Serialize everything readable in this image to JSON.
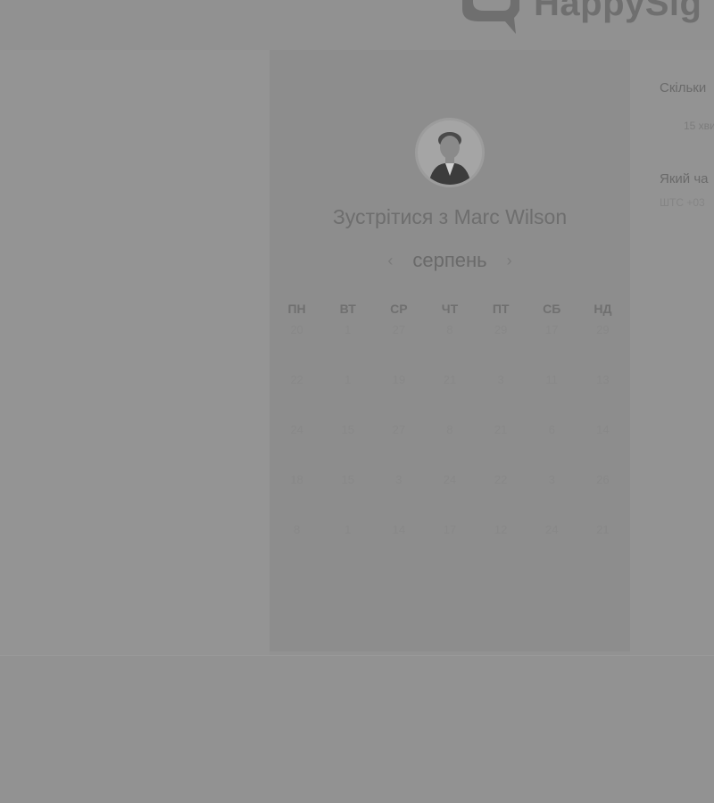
{
  "header": {
    "brand": "HappySig"
  },
  "card": {
    "title": "Зустрітися з Marc Wilson",
    "month": "серпень",
    "prev_icon": "chevron-left-icon",
    "next_icon": "chevron-right-icon",
    "weekdays": [
      "ПН",
      "ВТ",
      "СР",
      "ЧТ",
      "ПТ",
      "СБ",
      "НД"
    ],
    "weeks": [
      [
        "20",
        "1",
        "27",
        "8",
        "29",
        "17",
        "29"
      ],
      [
        "22",
        "1",
        "19",
        "21",
        "3",
        "11",
        "13"
      ],
      [
        "24",
        "15",
        "27",
        "8",
        "21",
        "6",
        "14"
      ],
      [
        "18",
        "15",
        "3",
        "24",
        "22",
        "3",
        "26"
      ],
      [
        "8",
        "1",
        "14",
        "17",
        "12",
        "24",
        "21"
      ]
    ]
  },
  "side": {
    "duration_question": "Скільки",
    "duration_value": "15 хви",
    "time_question": "Який ча",
    "time_value": "ШТС +03"
  }
}
